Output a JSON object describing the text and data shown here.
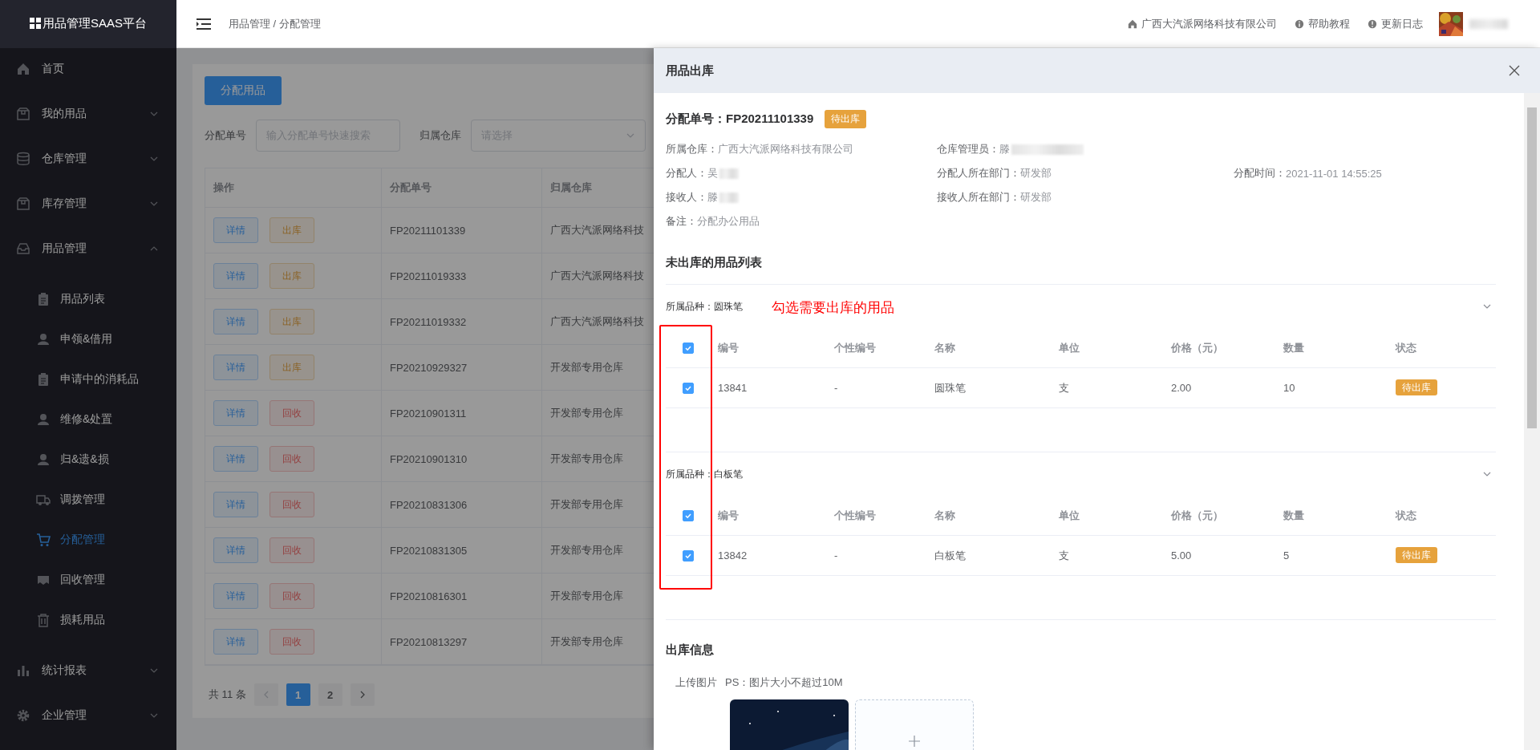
{
  "sidebar": {
    "logo": "用品管理SAAS平台",
    "items": [
      {
        "label": "首页"
      },
      {
        "label": "我的用品",
        "expanded": false
      },
      {
        "label": "仓库管理",
        "expanded": false
      },
      {
        "label": "库存管理",
        "expanded": false
      },
      {
        "label": "用品管理",
        "expanded": true,
        "children": [
          {
            "label": "用品列表",
            "selected": false
          },
          {
            "label": "申领&借用",
            "selected": false
          },
          {
            "label": "申请中的消耗品",
            "selected": false
          },
          {
            "label": "维修&处置",
            "selected": false
          },
          {
            "label": "归&遗&损",
            "selected": false
          },
          {
            "label": "调拨管理",
            "selected": false
          },
          {
            "label": "分配管理",
            "selected": true
          },
          {
            "label": "回收管理",
            "selected": false
          },
          {
            "label": "损耗用品",
            "selected": false
          }
        ]
      },
      {
        "label": "统计报表",
        "expanded": false
      },
      {
        "label": "企业管理",
        "expanded": false
      }
    ]
  },
  "topbar": {
    "breadcrumb": "用品管理 / 分配管理",
    "links": [
      "广西大汽派网络科技有限公司",
      "帮助教程",
      "更新日志"
    ],
    "avatar": {
      "kind": "picture"
    }
  },
  "main": {
    "add_button": "分配用品",
    "filters": [
      {
        "label": "分配单号",
        "placeholder": "输入分配单号快速搜索",
        "kind": "input"
      },
      {
        "label": "归属仓库",
        "placeholder": "请选择",
        "kind": "select"
      }
    ],
    "table": {
      "columns": [
        "操作",
        "分配单号",
        "归属仓库"
      ],
      "rows": [
        {
          "actions": [
            {
              "label": "详情",
              "kind": "detail"
            },
            {
              "label": "出库",
              "kind": "out"
            }
          ],
          "order": "FP20211101339",
          "warehouse": "广西大汽派网络科技"
        },
        {
          "actions": [
            {
              "label": "详情",
              "kind": "detail"
            },
            {
              "label": "出库",
              "kind": "out"
            }
          ],
          "order": "FP20211019333",
          "warehouse": "广西大汽派网络科技"
        },
        {
          "actions": [
            {
              "label": "详情",
              "kind": "detail"
            },
            {
              "label": "出库",
              "kind": "out"
            }
          ],
          "order": "FP20211019332",
          "warehouse": "广西大汽派网络科技"
        },
        {
          "actions": [
            {
              "label": "详情",
              "kind": "detail"
            },
            {
              "label": "出库",
              "kind": "out"
            }
          ],
          "order": "FP20210929327",
          "warehouse": "开发部专用仓库"
        },
        {
          "actions": [
            {
              "label": "详情",
              "kind": "detail"
            },
            {
              "label": "回收",
              "kind": "recycle"
            }
          ],
          "order": "FP20210901311",
          "warehouse": "开发部专用仓库"
        },
        {
          "actions": [
            {
              "label": "详情",
              "kind": "detail"
            },
            {
              "label": "回收",
              "kind": "recycle"
            }
          ],
          "order": "FP20210901310",
          "warehouse": "开发部专用仓库"
        },
        {
          "actions": [
            {
              "label": "详情",
              "kind": "detail"
            },
            {
              "label": "回收",
              "kind": "recycle"
            }
          ],
          "order": "FP20210831306",
          "warehouse": "开发部专用仓库"
        },
        {
          "actions": [
            {
              "label": "详情",
              "kind": "detail"
            },
            {
              "label": "回收",
              "kind": "recycle"
            }
          ],
          "order": "FP20210831305",
          "warehouse": "开发部专用仓库"
        },
        {
          "actions": [
            {
              "label": "详情",
              "kind": "detail"
            },
            {
              "label": "回收",
              "kind": "recycle"
            }
          ],
          "order": "FP20210816301",
          "warehouse": "开发部专用仓库"
        },
        {
          "actions": [
            {
              "label": "详情",
              "kind": "detail"
            },
            {
              "label": "回收",
              "kind": "recycle"
            }
          ],
          "order": "FP20210813297",
          "warehouse": "开发部专用仓库"
        }
      ]
    },
    "pagination": {
      "total": "共 11 条",
      "pages": [
        {
          "label": "1",
          "selected": true
        },
        {
          "label": "2",
          "selected": false
        }
      ]
    }
  },
  "drawer": {
    "title": "用品出库",
    "order_label": "分配单号：",
    "order_no": "FP20211101339",
    "status": "待出库",
    "info": [
      [
        {
          "label": "所属仓库：",
          "value": "广西大汽派网络科技有限公司"
        },
        {
          "label": "仓库管理员：",
          "value": "滕",
          "redacted": true
        }
      ],
      [
        {
          "label": "分配人：",
          "value": "吴",
          "redacted": true
        },
        {
          "label": "分配人所在部门：",
          "value": "研发部"
        },
        {
          "label": "分配时间：",
          "value": "2021-11-01 14:55:25"
        }
      ],
      [
        {
          "label": "接收人：",
          "value": "滕",
          "redacted": true
        },
        {
          "label": "接收人所在部门：",
          "value": "研发部"
        }
      ],
      [
        {
          "label": "备注：",
          "value": "分配办公用品"
        }
      ]
    ],
    "list_title": "未出库的用品列表",
    "annotation": "勾选需要出库的用品",
    "groups": [
      {
        "label": "所属品种：",
        "value": "圆珠笔",
        "expanded": true,
        "all_checked": true,
        "columns": [
          "编号",
          "个性编号",
          "名称",
          "单位",
          "价格（元）",
          "数量",
          "状态"
        ],
        "rows": [
          {
            "checked": true,
            "cells": [
              "13841",
              "-",
              "圆珠笔",
              "支",
              "2.00",
              "10"
            ],
            "status": "待出库"
          }
        ]
      },
      {
        "label": "所属品种：",
        "value": "白板笔",
        "expanded": true,
        "all_checked": true,
        "columns": [
          "编号",
          "个性编号",
          "名称",
          "单位",
          "价格（元）",
          "数量",
          "状态"
        ],
        "rows": [
          {
            "checked": true,
            "cells": [
              "13842",
              "-",
              "白板笔",
              "支",
              "5.00",
              "5"
            ],
            "status": "待出库"
          }
        ]
      }
    ],
    "out_info": {
      "title": "出库信息",
      "upload_label": "上传图片",
      "hint": "PS：图片大小不超过10M",
      "images": [
        {
          "kind": "picture"
        }
      ]
    }
  }
}
